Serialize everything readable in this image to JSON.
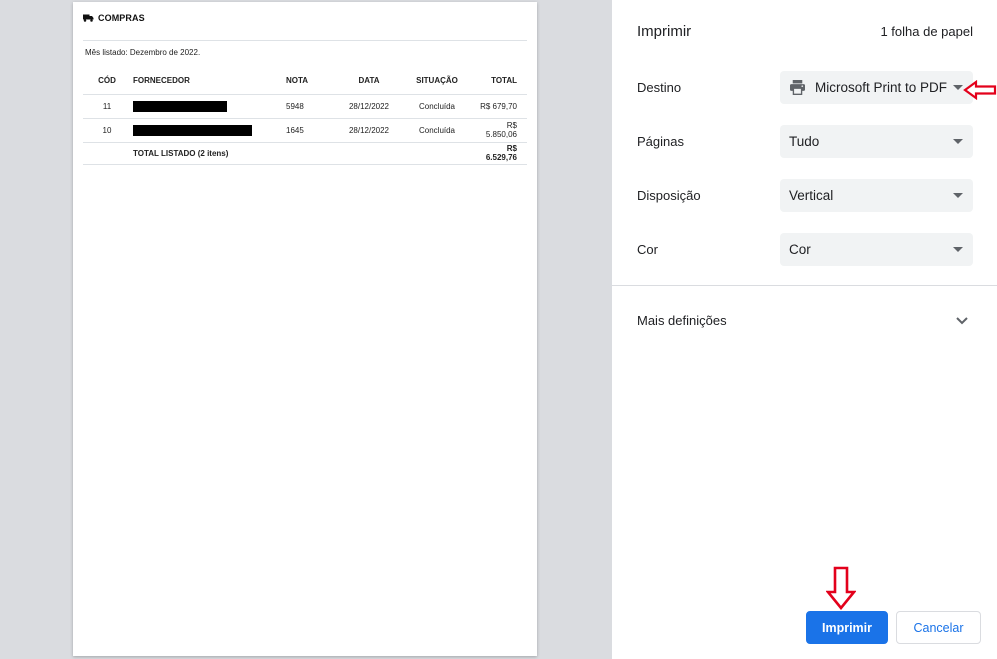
{
  "preview": {
    "doc_title": "COMPRAS",
    "month_line": "Mês listado: Dezembro de 2022.",
    "columns": [
      "CÓD",
      "FORNECEDOR",
      "NOTA",
      "DATA",
      "SITUAÇÃO",
      "TOTAL"
    ],
    "rows": [
      {
        "cod": "11",
        "nota": "5948",
        "data": "28/12/2022",
        "situacao": "Concluída",
        "total": "R$ 679,70"
      },
      {
        "cod": "10",
        "nota": "1645",
        "data": "28/12/2022",
        "situacao": "Concluída",
        "total": "R$ 5.850,06"
      }
    ],
    "total_label": "TOTAL LISTADO (2 itens)",
    "total_value": "R$ 6.529,76"
  },
  "panel": {
    "title": "Imprimir",
    "sheets": "1 folha de papel",
    "destino_label": "Destino",
    "destino_value": "Microsoft Print to PDF",
    "paginas_label": "Páginas",
    "paginas_value": "Tudo",
    "disposicao_label": "Disposição",
    "disposicao_value": "Vertical",
    "cor_label": "Cor",
    "cor_value": "Cor",
    "more_label": "Mais definições",
    "print_button": "Imprimir",
    "cancel_button": "Cancelar"
  },
  "colors": {
    "accent": "#1a73e8",
    "annotation": "#e3001b",
    "preview_bg": "#dadce0",
    "select_bg": "#f1f3f4"
  },
  "icons": {
    "doc_title_icon": "truck-icon",
    "destino_icon": "printer-icon",
    "select_arrow": "caret-down-icon",
    "more_icon": "chevron-down-icon",
    "annotations": [
      "red-arrow-left-icon",
      "red-arrow-down-icon"
    ]
  }
}
